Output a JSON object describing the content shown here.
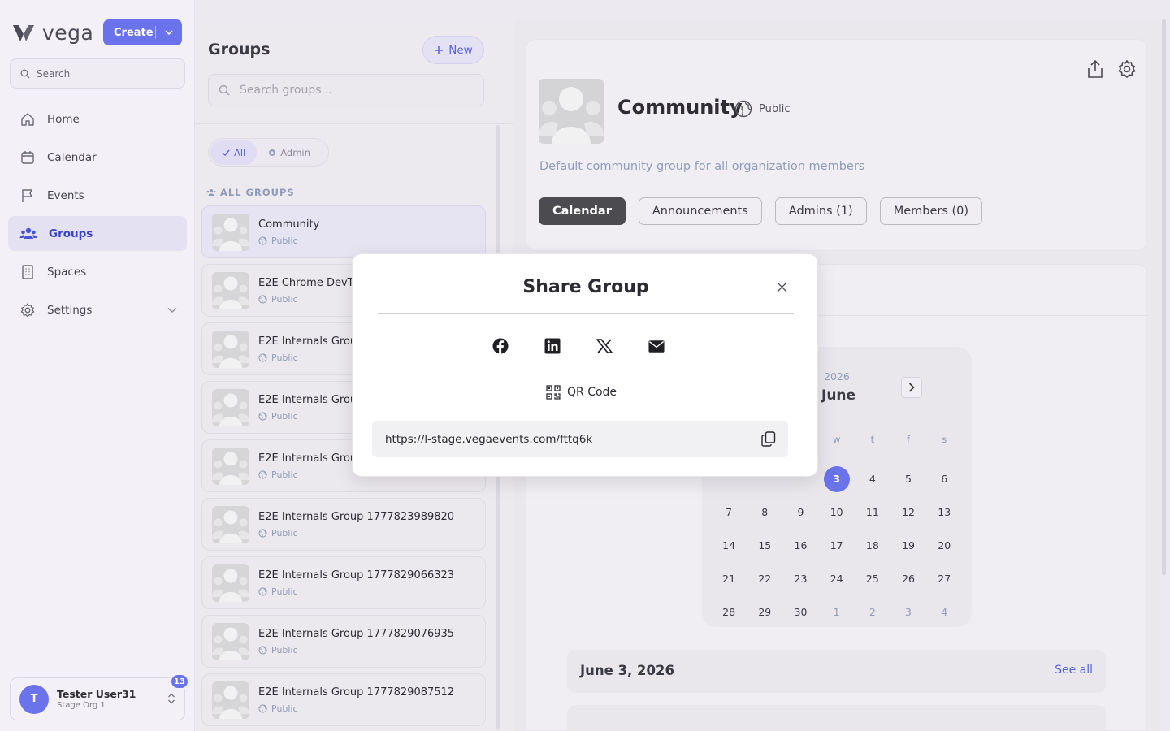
{
  "app": {
    "name": "vega",
    "create_label": "Create",
    "search_placeholder": "Search"
  },
  "nav": [
    {
      "label": "Home",
      "icon": "home-icon"
    },
    {
      "label": "Calendar",
      "icon": "calendar-icon"
    },
    {
      "label": "Events",
      "icon": "flag-icon"
    },
    {
      "label": "Groups",
      "icon": "users-icon",
      "active": true
    },
    {
      "label": "Spaces",
      "icon": "building-icon"
    },
    {
      "label": "Settings",
      "icon": "gear-icon"
    }
  ],
  "user": {
    "initial": "T",
    "name": "Tester User31",
    "org": "Stage Org 1",
    "notifications": "13"
  },
  "groups_panel": {
    "title": "Groups",
    "new_label": "New",
    "search_placeholder": "Search groups...",
    "filters": {
      "all": "All",
      "admin": "Admin"
    },
    "section_label": "ALL GROUPS",
    "items": [
      {
        "name": "Community",
        "visibility": "Public"
      },
      {
        "name": "E2E Chrome DevT",
        "visibility": "Public"
      },
      {
        "name": "E2E Internals Grou",
        "visibility": "Public"
      },
      {
        "name": "E2E Internals Grou",
        "visibility": "Public"
      },
      {
        "name": "E2E Internals Grou",
        "visibility": "Public"
      },
      {
        "name": "E2E Internals Group 1777823989820",
        "visibility": "Public"
      },
      {
        "name": "E2E Internals Group 1777829066323",
        "visibility": "Public"
      },
      {
        "name": "E2E Internals Group 1777829076935",
        "visibility": "Public"
      },
      {
        "name": "E2E Internals Group 1777829087512",
        "visibility": "Public"
      }
    ]
  },
  "detail": {
    "title": "Community",
    "visibility": "Public",
    "description": "Default community group for all organization members",
    "tabs": [
      "Calendar",
      "Announcements",
      "Admins (1)",
      "Members (0)"
    ],
    "active_tab": "Calendar"
  },
  "calendar": {
    "year": "2026",
    "month": "June",
    "days_of_week": [
      "w",
      "t",
      "f",
      "s"
    ],
    "selected_day": "3",
    "weeks": [
      [
        "",
        "",
        "",
        "3",
        "4",
        "5",
        "6"
      ],
      [
        "7",
        "8",
        "9",
        "10",
        "11",
        "12",
        "13"
      ],
      [
        "14",
        "15",
        "16",
        "17",
        "18",
        "19",
        "20"
      ],
      [
        "21",
        "22",
        "23",
        "24",
        "25",
        "26",
        "27"
      ],
      [
        "28",
        "29",
        "30",
        "1",
        "2",
        "3",
        "4"
      ]
    ]
  },
  "day_section": {
    "date": "June 3, 2026",
    "see_all": "See all"
  },
  "modal": {
    "title": "Share Group",
    "qr_label": "QR Code",
    "link": "https://l-stage.vegaevents.com/fttq6k",
    "share_icons": [
      "facebook-icon",
      "linkedin-icon",
      "x-icon",
      "email-icon"
    ]
  },
  "colors": {
    "accent": "#6a73eb",
    "muted_blue": "#8f9cba",
    "dark_tab": "#4b4b50"
  }
}
